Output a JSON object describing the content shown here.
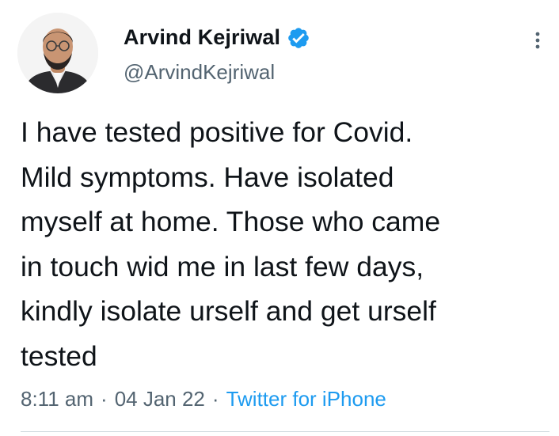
{
  "tweet": {
    "author": {
      "display_name": "Arvind Kejriwal",
      "handle": "@ArvindKejriwal",
      "verified": true,
      "avatar_icon": "profile-photo"
    },
    "text": "I have tested positive for Covid.\nMild symptoms. Have isolated\nmyself at home. Those who came\nin touch wid me in last few days,\nkindly isolate urself and get urself\ntested",
    "meta": {
      "time": "8:11 am",
      "separator": "·",
      "date": "04 Jan 22",
      "source": "Twitter for iPhone"
    },
    "more_icon": "more-vertical-icon"
  },
  "colors": {
    "text_primary": "#0f1419",
    "text_secondary": "#536471",
    "accent": "#1d9bf0",
    "divider": "#cfd9de"
  }
}
